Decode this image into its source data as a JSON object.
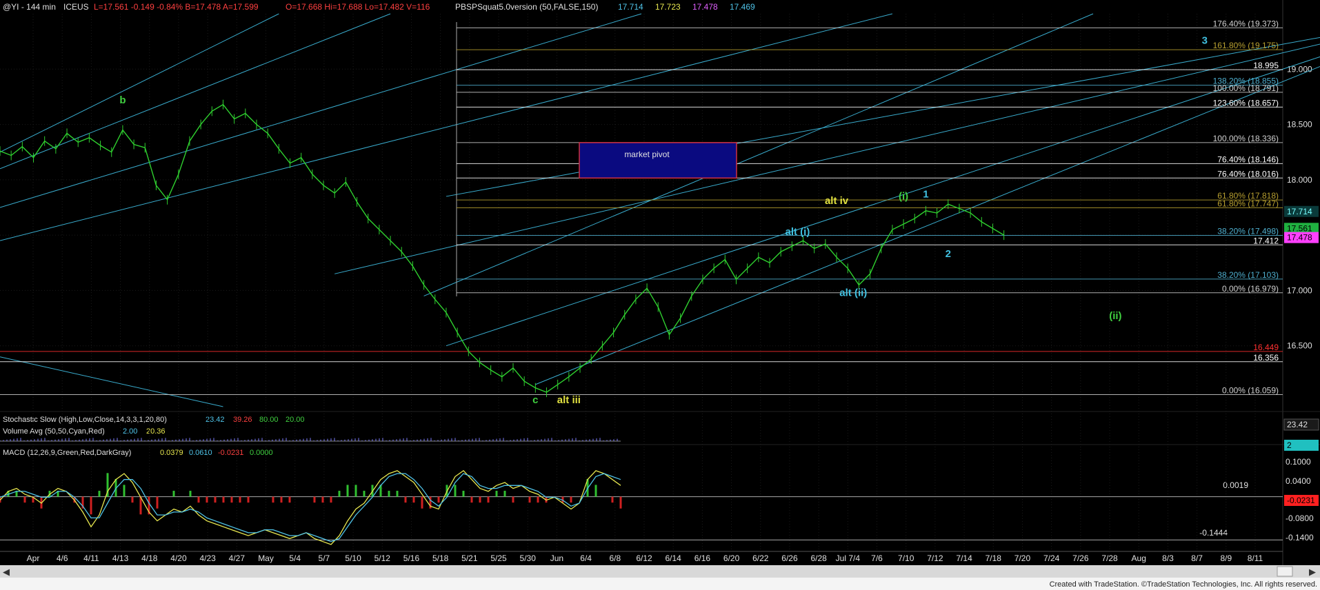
{
  "window": {
    "header_symbol": "@YI - 144 min",
    "header_exchange": "ICEUS",
    "header_quote": "L=17.561 -0.149 -0.84% B=17.478 A=17.599",
    "header_ohlc": "O=17.668 Hi=17.688 Lo=17.482 V=116",
    "header_indicator": "PBSPSquat5.0version (50,FALSE,150)",
    "header_values": [
      "17.714",
      "17.723",
      "17.478",
      "17.469"
    ],
    "header_value_colors": [
      "#4fc3e8",
      "#e8e84f",
      "#e060ff",
      "#4fc3e8"
    ],
    "footer_credit": "Created with TradeStation. ©TradeStation Technologies, Inc. All rights reserved."
  },
  "chart_data": [
    {
      "type": "line",
      "panel": "price",
      "y_axis_ticks": [
        "19.000",
        "18.500",
        "18.000",
        "17.500",
        "17.000",
        "16.500"
      ],
      "ylim": [
        15.95,
        19.5
      ],
      "x_tick_labels": [
        "Apr",
        "4/6",
        "4/11",
        "4/13",
        "4/18",
        "4/20",
        "4/23",
        "4/27",
        "May",
        "5/4",
        "5/7",
        "5/10",
        "5/12",
        "5/16",
        "5/18",
        "5/21",
        "5/25",
        "5/30",
        "Jun",
        "6/4",
        "6/8",
        "6/12",
        "6/14",
        "6/16",
        "6/20",
        "6/22",
        "6/26",
        "6/28",
        "Jul 7/4",
        "7/6",
        "7/10",
        "7/12",
        "7/14",
        "7/18",
        "7/20",
        "7/24",
        "7/26",
        "7/28",
        "Aug",
        "8/3",
        "8/7",
        "8/9",
        "8/11"
      ],
      "price_series": {
        "x": [
          0,
          2,
          4,
          6,
          8,
          10,
          12,
          14,
          16,
          18,
          20,
          22,
          24,
          26,
          28,
          30,
          32,
          34,
          36,
          38,
          40,
          42,
          44,
          46,
          48,
          50,
          52,
          54,
          56,
          58,
          60,
          62,
          64,
          66,
          68,
          70,
          72,
          74,
          76,
          78,
          80,
          82,
          84,
          86,
          88,
          90,
          92,
          94,
          96,
          98,
          100,
          102,
          104,
          106,
          108,
          110,
          112,
          114,
          116,
          118,
          120,
          122,
          124,
          126,
          128,
          130,
          132,
          134,
          136,
          138,
          140,
          142,
          144,
          146,
          148,
          150,
          152,
          154,
          156,
          158,
          160,
          162,
          164,
          166,
          168,
          170,
          172,
          174,
          176,
          178,
          180
        ],
        "y": [
          18.26,
          18.22,
          18.3,
          18.2,
          18.35,
          18.28,
          18.42,
          18.34,
          18.38,
          18.31,
          18.25,
          18.45,
          18.32,
          18.29,
          17.95,
          17.82,
          18.05,
          18.35,
          18.5,
          18.62,
          18.68,
          18.55,
          18.6,
          18.5,
          18.42,
          18.28,
          18.15,
          18.2,
          18.05,
          17.95,
          17.88,
          17.98,
          17.8,
          17.65,
          17.55,
          17.45,
          17.35,
          17.22,
          17.05,
          16.92,
          16.8,
          16.62,
          16.45,
          16.35,
          16.28,
          16.22,
          16.3,
          16.18,
          16.12,
          16.08,
          16.15,
          16.22,
          16.3,
          16.38,
          16.5,
          16.62,
          16.78,
          16.92,
          17.02,
          16.85,
          16.6,
          16.75,
          16.95,
          17.1,
          17.2,
          17.28,
          17.1,
          17.2,
          17.3,
          17.25,
          17.35,
          17.4,
          17.45,
          17.38,
          17.42,
          17.3,
          17.2,
          17.05,
          17.15,
          17.38,
          17.55,
          17.6,
          17.65,
          17.72,
          17.7,
          17.78,
          17.74,
          17.7,
          17.62,
          17.56,
          17.5
        ]
      },
      "price_levels": [
        {
          "label": "176.40% (19.373)",
          "value": 19.373,
          "color": "#d0d0d0"
        },
        {
          "label": "161.80% (19.175)",
          "value": 19.175,
          "color": "#b8a030"
        },
        {
          "label": "18.995",
          "value": 18.995,
          "color": "#ffffff"
        },
        {
          "label": "138.20% (18.855)",
          "value": 18.855,
          "color": "#4fb0d0"
        },
        {
          "label": "100.00% (18.791)",
          "value": 18.791,
          "color": "#d0d0d0"
        },
        {
          "label": "123.60% (18.657)",
          "value": 18.657,
          "color": "#ffffff"
        },
        {
          "label": "100.00% (18.336)",
          "value": 18.336,
          "color": "#d0d0d0"
        },
        {
          "label": "76.40% (18.146)",
          "value": 18.146,
          "color": "#ffffff"
        },
        {
          "label": "76.40% (18.016)",
          "value": 18.016,
          "color": "#ffffff"
        },
        {
          "label": "61.80% (17.818)",
          "value": 17.818,
          "color": "#b8a030"
        },
        {
          "label": "61.80% (17.747)",
          "value": 17.747,
          "color": "#b8a030"
        },
        {
          "label": "38.20% (17.498)",
          "value": 17.498,
          "color": "#4fb0d0"
        },
        {
          "label": "17.412",
          "value": 17.412,
          "color": "#ffffff"
        },
        {
          "label": "38.20% (17.103)",
          "value": 17.103,
          "color": "#4fb0d0"
        },
        {
          "label": "0.00% (16.979)",
          "value": 16.979,
          "color": "#d0d0d0"
        },
        {
          "label": "16.449",
          "value": 16.449,
          "color": "#ff3030"
        },
        {
          "label": "16.356",
          "value": 16.356,
          "color": "#ffffff"
        },
        {
          "label": "0.00% (16.059)",
          "value": 16.059,
          "color": "#d0d0d0"
        }
      ],
      "price_boxes": [
        {
          "label": "17.714",
          "value": 17.714,
          "bg": "#0a3a3a",
          "fg": "#7ff"
        },
        {
          "label": "17.561",
          "value": 17.561,
          "bg": "#20b040",
          "fg": "#000"
        },
        {
          "label": "17.478",
          "value": 17.478,
          "bg": "#ff40ff",
          "fg": "#000"
        }
      ],
      "market_pivot": {
        "label": "market pivot",
        "top": 18.336,
        "bottom": 18.016
      },
      "wave_labels": [
        {
          "text": "b",
          "x": 22,
          "y": 18.69,
          "color": "#40d040"
        },
        {
          "text": "c",
          "x": 96,
          "y": 15.98,
          "color": "#40d040"
        },
        {
          "text": "alt iii",
          "x": 102,
          "y": 15.98,
          "color": "#e0e040"
        },
        {
          "text": "alt iv",
          "x": 150,
          "y": 17.78,
          "color": "#e0e040"
        },
        {
          "text": "alt (i)",
          "x": 143,
          "y": 17.5,
          "color": "#40c0e0"
        },
        {
          "text": "alt (ii)",
          "x": 153,
          "y": 16.95,
          "color": "#40c0e0"
        },
        {
          "text": "(i)",
          "x": 162,
          "y": 17.82,
          "color": "#40d040"
        },
        {
          "text": "1",
          "x": 166,
          "y": 17.84,
          "color": "#40c0e0"
        },
        {
          "text": "2",
          "x": 170,
          "y": 17.3,
          "color": "#40c0e0"
        },
        {
          "text": "3",
          "x": 216,
          "y": 19.23,
          "color": "#40c0e0"
        },
        {
          "text": "(ii)",
          "x": 200,
          "y": 16.74,
          "color": "#40d040"
        }
      ]
    },
    {
      "type": "line",
      "panel": "stochastic",
      "title": "Stochastic Slow (High,Low,Close,14,3,3,1,20,80)",
      "values": [
        "23.42",
        "39.26",
        "80.00",
        "20.00"
      ],
      "value_colors": [
        "#4fc3e8",
        "#ff4040",
        "#40d040",
        "#40d040"
      ],
      "axis_box": "23.42"
    },
    {
      "type": "bar",
      "panel": "volume",
      "title": "Volume Avg (50,50,Cyan,Red)",
      "values": [
        "2.00",
        "20.36"
      ],
      "value_colors": [
        "#4fc3e8",
        "#e8e84f"
      ],
      "axis_box": "2"
    },
    {
      "type": "line",
      "panel": "macd",
      "title": "MACD (12,26,9,Green,Red,DarkGray)",
      "values": [
        "0.0379",
        "0.0610",
        "-0.0231",
        "0.0000"
      ],
      "value_colors": [
        "#e8e84f",
        "#4fc3e8",
        "#ff4040",
        "#40d040"
      ],
      "y_axis_ticks": [
        "0.1000",
        "0.0400",
        "-0.0800",
        "-0.1400"
      ],
      "level_labels": [
        "0.0019",
        "-0.1444"
      ],
      "axis_box": "-0.0231",
      "macd_series": [
        -0.01,
        0.02,
        0.03,
        0.01,
        0.0,
        -0.02,
        0.01,
        0.03,
        0.02,
        -0.01,
        -0.05,
        -0.1,
        -0.06,
        0.02,
        0.06,
        0.08,
        0.05,
        0.0,
        -0.05,
        -0.08,
        -0.06,
        -0.04,
        -0.05,
        -0.03,
        -0.06,
        -0.08,
        -0.09,
        -0.1,
        -0.11,
        -0.12,
        -0.13,
        -0.12,
        -0.11,
        -0.12,
        -0.13,
        -0.14,
        -0.13,
        -0.12,
        -0.14,
        -0.15,
        -0.16,
        -0.13,
        -0.08,
        -0.04,
        -0.02,
        0.02,
        0.06,
        0.08,
        0.09,
        0.07,
        0.05,
        0.01,
        -0.03,
        -0.04,
        0.02,
        0.07,
        0.09,
        0.06,
        0.03,
        0.02,
        0.04,
        0.05,
        0.03,
        0.04,
        0.02,
        0.01,
        -0.01,
        0.0,
        -0.02,
        -0.04,
        -0.02,
        0.06,
        0.09,
        0.08,
        0.06,
        0.04
      ],
      "signal_series": [
        0.0,
        0.01,
        0.02,
        0.02,
        0.01,
        0.0,
        0.0,
        0.02,
        0.02,
        0.0,
        -0.03,
        -0.07,
        -0.07,
        -0.02,
        0.03,
        0.06,
        0.06,
        0.03,
        -0.02,
        -0.06,
        -0.06,
        -0.05,
        -0.05,
        -0.04,
        -0.05,
        -0.07,
        -0.08,
        -0.09,
        -0.1,
        -0.11,
        -0.12,
        -0.12,
        -0.11,
        -0.11,
        -0.12,
        -0.13,
        -0.13,
        -0.12,
        -0.13,
        -0.14,
        -0.15,
        -0.14,
        -0.1,
        -0.06,
        -0.03,
        0.0,
        0.04,
        0.07,
        0.08,
        0.08,
        0.06,
        0.03,
        -0.01,
        -0.03,
        0.0,
        0.05,
        0.08,
        0.07,
        0.04,
        0.03,
        0.03,
        0.04,
        0.04,
        0.04,
        0.03,
        0.02,
        0.0,
        0.0,
        -0.01,
        -0.03,
        -0.02,
        0.03,
        0.07,
        0.08,
        0.07,
        0.06
      ]
    }
  ]
}
